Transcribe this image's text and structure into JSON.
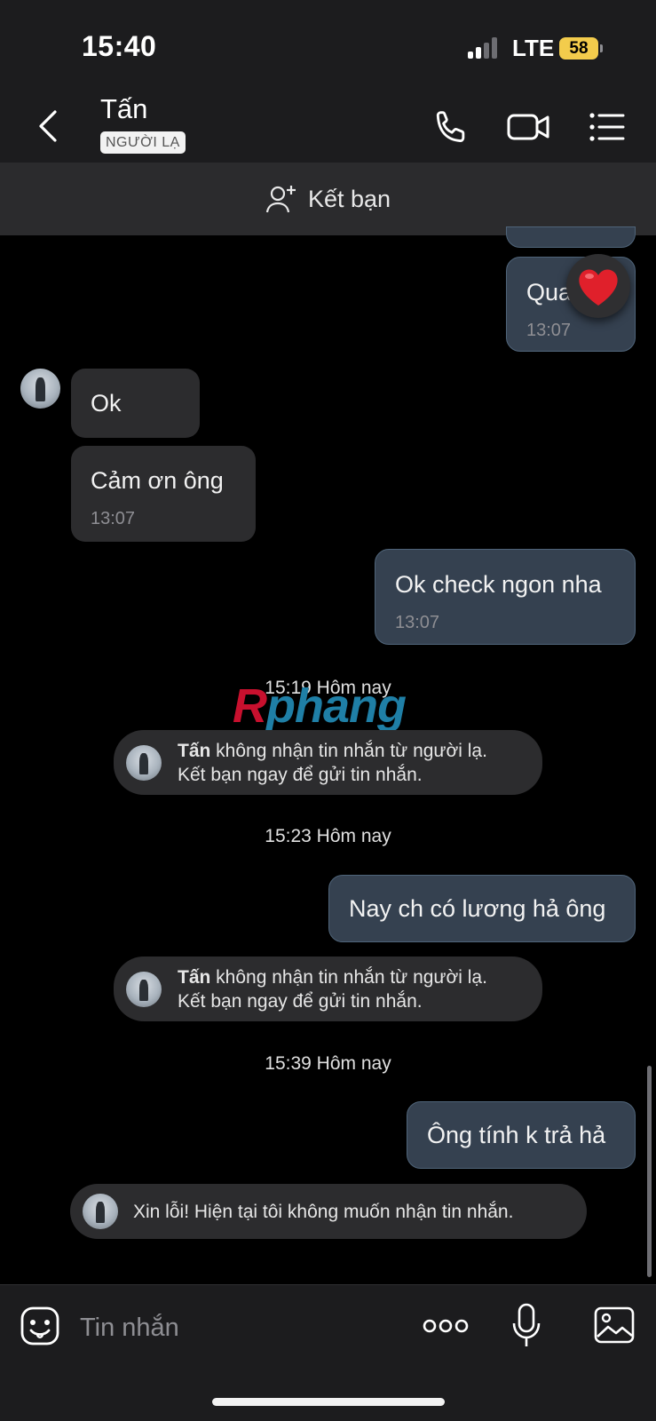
{
  "status_bar": {
    "time": "15:40",
    "network": "LTE",
    "battery": "58"
  },
  "header": {
    "contact_name": "Tấn",
    "badge": "NGƯỜI LẠ"
  },
  "friend_bar": {
    "label": "Kết bạn"
  },
  "messages": {
    "partial_out_text": "Qua",
    "partial_out_time": "13:07",
    "reaction": "❤️",
    "in_ok": "Ok",
    "in_thanks": "Cảm ơn ông",
    "in_thanks_time": "13:07",
    "out_check": "Ok check ngon nha",
    "out_check_time": "13:07",
    "date_1": "15:19 Hôm nay",
    "notice_name": "Tấn",
    "notice_line1": " không nhận tin nhắn từ người lạ.",
    "notice_line2": "Kết bạn ngay để gửi tin nhắn.",
    "date_2": "15:23 Hôm nay",
    "out_salary": "Nay ch có lương hả ông",
    "date_3": "15:39 Hôm nay",
    "out_reply": "Ông tính k trả hả",
    "auto_reply": "Xin lỗi! Hiện tại tôi không muốn nhận tin nhắn."
  },
  "watermark": {
    "part1": "R",
    "part2": "phang"
  },
  "composer": {
    "placeholder": "Tin nhắn"
  },
  "colors": {
    "bubble_out": "#354150",
    "bubble_in": "#2c2c2e",
    "bar": "#1c1c1e",
    "battery": "#f3cc4c"
  },
  "icons": [
    "back-chevron-icon",
    "phone-icon",
    "video-call-icon",
    "menu-list-icon",
    "add-friend-icon",
    "heart-icon",
    "sticker-icon",
    "more-icon",
    "microphone-icon",
    "image-icon"
  ]
}
